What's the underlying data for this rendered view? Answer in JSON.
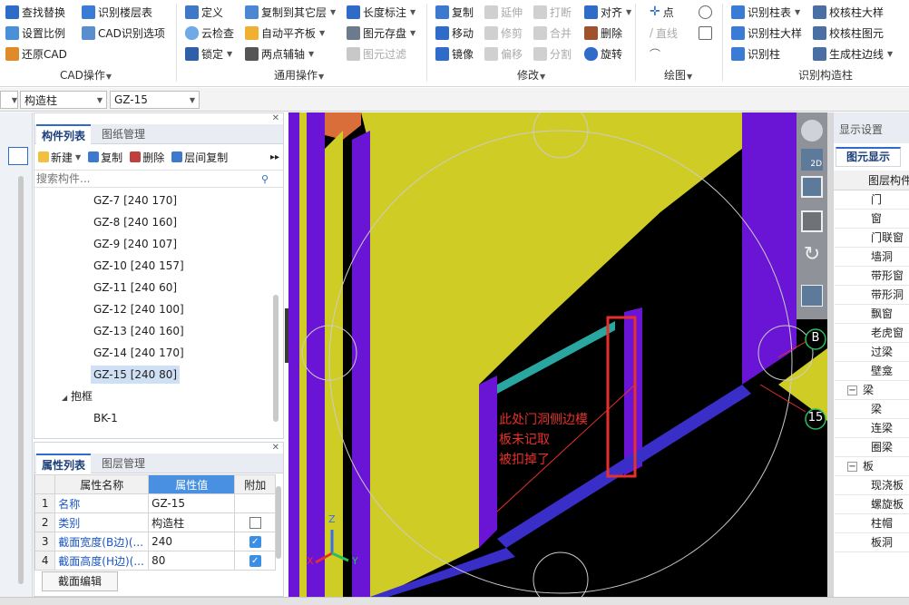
{
  "ribbon": {
    "cad_ops": {
      "label": "CAD操作",
      "items": [
        "查找替换",
        "识别楼层表",
        "设置比例",
        "CAD识别选项",
        "还原CAD"
      ]
    },
    "general_ops": {
      "label": "通用操作",
      "items": [
        "定义",
        "复制到其它层",
        "长度标注",
        "云检查",
        "自动平齐板",
        "图元存盘",
        "锁定",
        "两点辅轴",
        "图元过滤"
      ]
    },
    "modify": {
      "label": "修改",
      "items": [
        "复制",
        "延伸",
        "打断",
        "对齐",
        "移动",
        "修剪",
        "合并",
        "删除",
        "镜像",
        "偏移",
        "分割",
        "旋转"
      ]
    },
    "draw": {
      "label": "绘图",
      "items": [
        "点",
        "直线"
      ]
    },
    "identify_col": {
      "label": "识别构造柱",
      "items": [
        "识别柱表",
        "校核柱大样",
        "识别柱大样",
        "校核柱图元",
        "识别柱",
        "生成柱边线"
      ]
    }
  },
  "selectors": {
    "first": "",
    "type": "构造柱",
    "item": "GZ-15"
  },
  "component_list": {
    "tabs": [
      "构件列表",
      "图纸管理"
    ],
    "toolbar": [
      "新建",
      "复制",
      "删除",
      "层间复制"
    ],
    "search_placeholder": "搜索构件...",
    "items": [
      "GZ-7 [240 170]",
      "GZ-8 [240 160]",
      "GZ-9 [240 107]",
      "GZ-10 [240 157]",
      "GZ-11 [240 60]",
      "GZ-12 [240 100]",
      "GZ-13 [240 160]",
      "GZ-14 [240 170]",
      "GZ-15 [240 80]"
    ],
    "group_label": "抱框",
    "group_items": [
      "BK-1"
    ]
  },
  "properties": {
    "tabs": [
      "属性列表",
      "图层管理"
    ],
    "headers": [
      "属性名称",
      "属性值",
      "附加"
    ],
    "rows": [
      {
        "num": "1",
        "name": "名称",
        "value": "GZ-15",
        "check": "none"
      },
      {
        "num": "2",
        "name": "类别",
        "value": "构造柱",
        "check": "unchecked"
      },
      {
        "num": "3",
        "name": "截面宽度(B边)(...",
        "value": "240",
        "check": "checked"
      },
      {
        "num": "4",
        "name": "截面高度(H边)(...",
        "value": "80",
        "check": "checked"
      }
    ],
    "button": "截面编辑"
  },
  "viewport": {
    "annotation_lines": [
      "此处门洞侧边模",
      "板未记取",
      "被扣掉了"
    ],
    "axis_labels": {
      "b": "B",
      "n15": "15"
    },
    "nav_labels": {
      "two_d": "2D"
    },
    "gizmo": {
      "z": "Z",
      "x": "X",
      "y": "Y"
    },
    "colors": {
      "wall": "#cfcc25",
      "beam": "#6a14d6",
      "slab": "#000000",
      "highlight": "#e8302a",
      "teal": "#2aa6a0"
    }
  },
  "display_settings": {
    "title": "显示设置",
    "tab": "图元显示",
    "header": "图层构件",
    "rows": [
      {
        "label": "门",
        "indent": true
      },
      {
        "label": "窗",
        "indent": true
      },
      {
        "label": "门联窗",
        "indent": true
      },
      {
        "label": "墙洞",
        "indent": true
      },
      {
        "label": "带形窗",
        "indent": true
      },
      {
        "label": "带形洞",
        "indent": true
      },
      {
        "label": "飘窗",
        "indent": true
      },
      {
        "label": "老虎窗",
        "indent": true
      },
      {
        "label": "过梁",
        "indent": true
      },
      {
        "label": "壁龛",
        "indent": true
      },
      {
        "label": "梁",
        "indent": false
      },
      {
        "label": "梁",
        "indent": true
      },
      {
        "label": "连梁",
        "indent": true
      },
      {
        "label": "圈梁",
        "indent": true
      },
      {
        "label": "板",
        "indent": false
      },
      {
        "label": "现浇板",
        "indent": true
      },
      {
        "label": "螺旋板",
        "indent": true
      },
      {
        "label": "柱帽",
        "indent": true
      },
      {
        "label": "板洞",
        "indent": true
      }
    ]
  }
}
